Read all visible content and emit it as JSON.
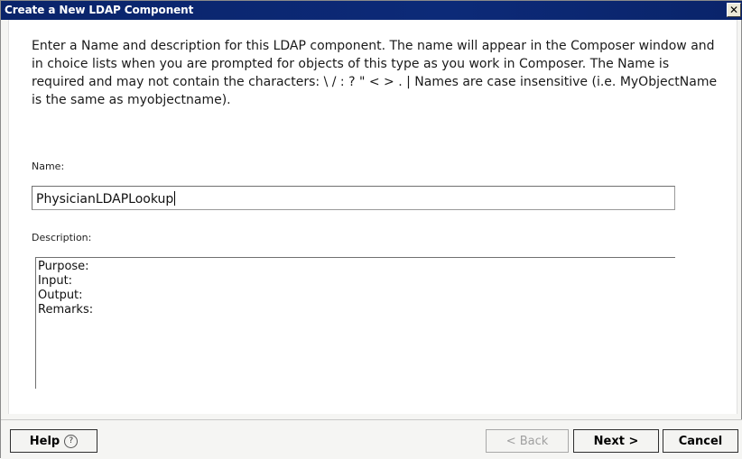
{
  "window": {
    "title": "Create a New LDAP Component",
    "close_symbol": "✕"
  },
  "intro_text": "Enter a Name and description for this LDAP component.  The name will appear in the Composer window and in choice lists when you are prompted for objects of this type as you work in Composer.  The Name is required and may not contain the characters: \\ / : ? \" < > . |  Names are case insensitive (i.e. MyObjectName is the same as myobjectname).",
  "name_field": {
    "label": "Name:",
    "value": "PhysicianLDAPLookup"
  },
  "description_field": {
    "label": "Description:",
    "lines": [
      "Purpose:",
      "Input:",
      "Output:",
      "Remarks:"
    ]
  },
  "buttons": {
    "help_label": "Help",
    "help_icon": "question-circle-icon",
    "back_label": "< Back",
    "back_enabled": false,
    "next_label": "Next >",
    "cancel_label": "Cancel"
  }
}
